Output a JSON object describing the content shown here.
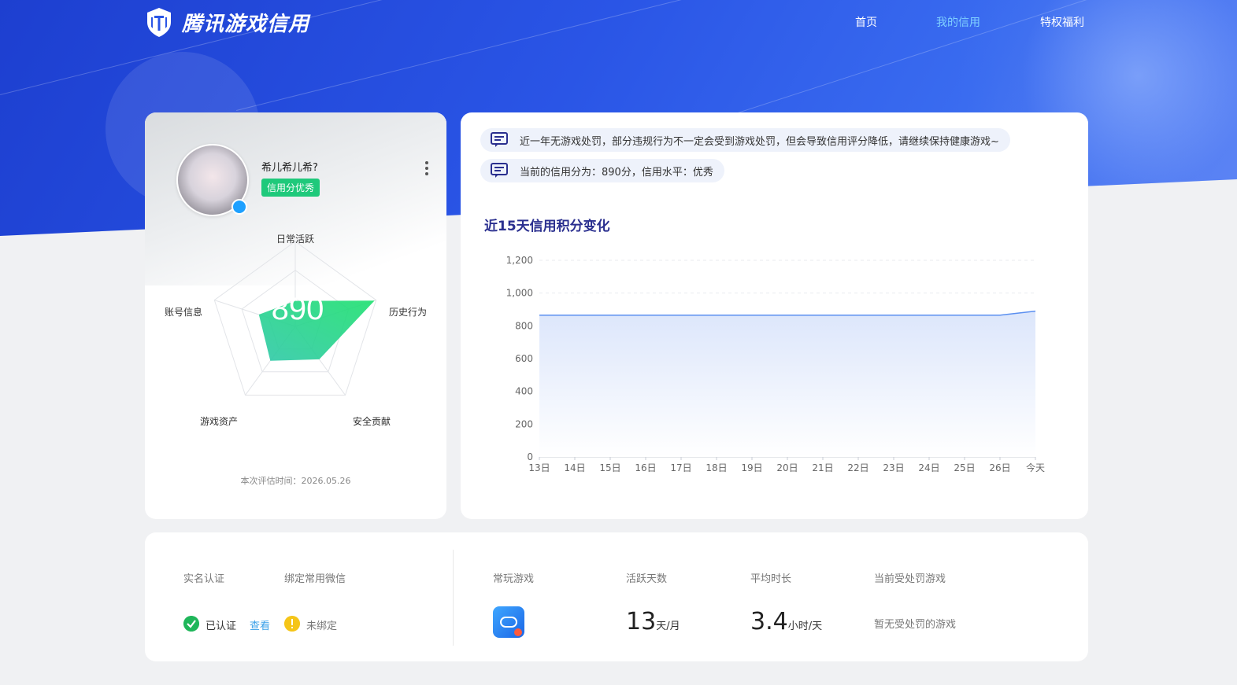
{
  "header": {
    "brand": "腾讯游戏信用",
    "nav": [
      {
        "label": "首页",
        "active": false
      },
      {
        "label": "我的信用",
        "active": true
      },
      {
        "label": "特权福利",
        "active": false
      }
    ]
  },
  "profile": {
    "username": "希儿希儿希?",
    "credit_badge": "信用分优秀",
    "score": "890",
    "radar_labels": [
      "日常活跃",
      "历史行为",
      "安全贡献",
      "游戏资产",
      "账号信息"
    ],
    "radar_values": [
      0.3,
      0.98,
      0.48,
      0.5,
      0.45
    ],
    "eval_time": "本次评估时间：2026.05.26"
  },
  "notices": [
    "近一年无游戏处罚，部分违规行为不一定会受到游戏处罚，但会导致信用评分降低，请继续保持健康游戏~",
    "当前的信用分为：890分，信用水平：优秀"
  ],
  "chart": {
    "title": "近15天信用积分变化"
  },
  "chart_data": {
    "type": "area",
    "title": "近15天信用积分变化",
    "categories": [
      "13日",
      "14日",
      "15日",
      "16日",
      "17日",
      "18日",
      "19日",
      "20日",
      "21日",
      "22日",
      "23日",
      "24日",
      "25日",
      "26日",
      "今天"
    ],
    "values": [
      865,
      865,
      865,
      865,
      865,
      865,
      865,
      865,
      865,
      865,
      865,
      865,
      865,
      865,
      890
    ],
    "xlabel": "",
    "ylabel": "",
    "ylim": [
      0,
      1200
    ],
    "yticks": [
      "0",
      "200",
      "400",
      "600",
      "800",
      "1,000",
      "1,200"
    ],
    "grid": true,
    "line_color": "#5b8ff0"
  },
  "bottom": {
    "real_name_label": "实名认证",
    "wechat_label": "绑定常用微信",
    "real_name_status": "已认证",
    "view_link": "查看",
    "wechat_status": "未绑定",
    "frequent_game_label": "常玩游戏",
    "active_days_label": "活跃天数",
    "active_days_value": "13",
    "active_days_unit": "天/月",
    "avg_time_label": "平均时长",
    "avg_time_value": "3.4",
    "avg_time_unit": "小时/天",
    "penalty_label": "当前受处罚游戏",
    "penalty_value": "暂无受处罚的游戏"
  }
}
